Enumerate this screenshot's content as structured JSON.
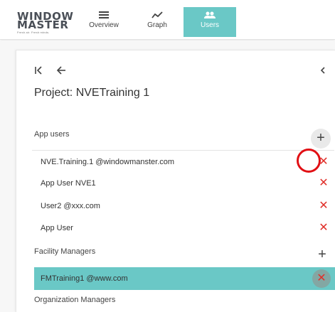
{
  "logo": {
    "line1": "WINDOW",
    "line2": "MASTER",
    "tagline": "Fresh air. Fresh minds."
  },
  "nav": {
    "tabs": [
      {
        "label": "Overview",
        "icon": "menu-icon",
        "active": false
      },
      {
        "label": "Graph",
        "icon": "chart-line-icon",
        "active": false
      },
      {
        "label": "Users",
        "icon": "users-icon",
        "active": true
      }
    ]
  },
  "project": {
    "title": "Project: NVETraining 1"
  },
  "app_users": {
    "label": "App users",
    "add_icon": "+",
    "items": [
      {
        "name": "NVE.Training.1 @windowmanster.com",
        "remove": "✕"
      },
      {
        "name": "App User NVE1",
        "remove": "✕"
      },
      {
        "name": "User2 @xxx.com",
        "remove": "✕"
      },
      {
        "name": "App User",
        "remove": "✕"
      }
    ]
  },
  "facility_managers": {
    "label": "Facility Managers",
    "add_icon": "+",
    "items": [
      {
        "name": "FMTraining1 @www.com",
        "remove": "✕"
      }
    ]
  },
  "organization_managers": {
    "label": "Organization Managers"
  },
  "colors": {
    "accent": "#6ac8c6",
    "remove": "#e0302a",
    "highlight": "#e10f14"
  }
}
